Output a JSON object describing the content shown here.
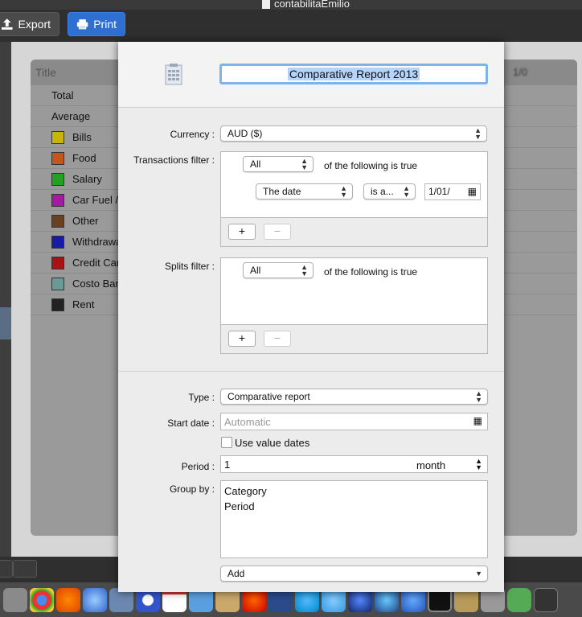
{
  "window": {
    "title": "contabilitaEmilio"
  },
  "toolbar": {
    "export_label": "Export",
    "print_label": "Print"
  },
  "table": {
    "title_header": "Title",
    "col2_header": "1/0",
    "rows": [
      {
        "name": "Total",
        "color": null
      },
      {
        "name": "Average",
        "color": null
      },
      {
        "name": "Bills",
        "color": "#c8b40a"
      },
      {
        "name": "Food",
        "color": "#c5561a"
      },
      {
        "name": "Salary",
        "color": "#23a123"
      },
      {
        "name": "Car Fuel /",
        "color": "#a31aa3"
      },
      {
        "name": "Other",
        "color": "#6b4020"
      },
      {
        "name": "Withdrawa",
        "color": "#1a1aa8"
      },
      {
        "name": "Credit Car",
        "color": "#a81212"
      },
      {
        "name": "Costo Ban",
        "color": "#6a9a96"
      },
      {
        "name": "Rent",
        "color": "#222222"
      }
    ]
  },
  "sheet": {
    "report_title": "Comparative Report 2013",
    "currency_label": "Currency :",
    "currency_value": "AUD ($)",
    "transactions_filter_label": "Transactions filter :",
    "tx_match": "All",
    "tx_match_suffix": "of the following is true",
    "tx_rule_field": "The date",
    "tx_rule_op": "is a...",
    "tx_rule_value": "1/01/",
    "add_btn": "+",
    "remove_btn": "−",
    "splits_filter_label": "Splits filter :",
    "sp_match": "All",
    "sp_match_suffix": "of the following is true",
    "type_label": "Type :",
    "type_value": "Comparative report",
    "start_label": "Start date :",
    "start_placeholder": "Automatic",
    "use_value_dates": "Use value dates",
    "period_label": "Period :",
    "period_value": "1",
    "period_unit": "month",
    "group_label": "Group by :",
    "group_items": [
      "Category",
      "Period"
    ],
    "add_popup": "Add"
  }
}
